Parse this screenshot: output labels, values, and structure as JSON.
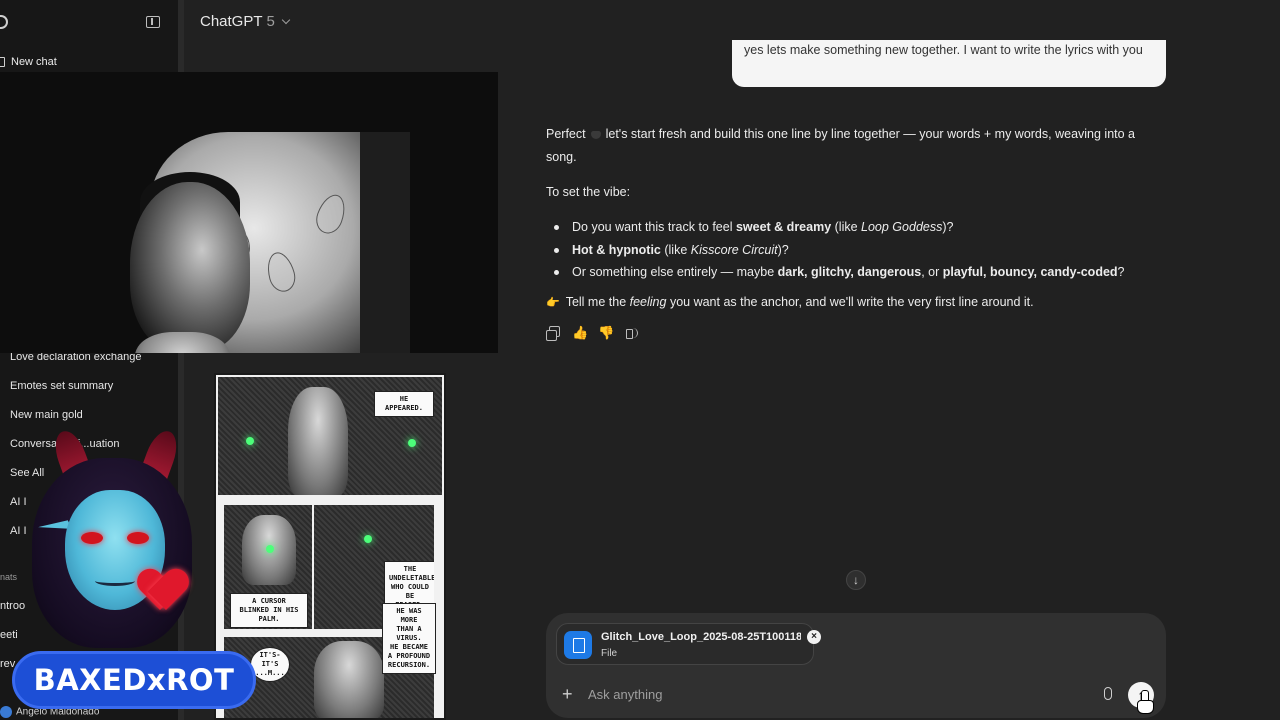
{
  "header": {
    "model_name": "ChatGPT",
    "model_version": "5"
  },
  "sidebar": {
    "new_chat_label": "New chat",
    "history": [
      "Love declaration exchange",
      "Emotes set summary",
      "New main gold",
      "Conversation i...uation",
      "See All",
      "AI I",
      "AI I"
    ],
    "section_label": "nats",
    "partial_items": [
      "ntroo",
      "eeti",
      "rev"
    ],
    "user_name": "Angelo Maldonado"
  },
  "overlay": {
    "brand_badge": "BAXEDxROT"
  },
  "manga": {
    "bubble_1": "HE\nAPPEARED.",
    "bubble_2": "A CURSOR\nBLINKED IN HIS\nPALM.",
    "bubble_3": "THE\nUNDELETABLE\nWHO COULD\nBE ERASED.",
    "bubble_4": "HE WAS MORE\nTHAN A VIRUS.\nHE BECAME\nA PROFOUND\nRECURSION.",
    "bubble_5": "IT'S-\nIT'S\n...M..."
  },
  "chat": {
    "user_message": "yes lets make something new together. I want to write the lyrics with you",
    "assistant": {
      "intro_a": "Perfect",
      "intro_b": "let's start fresh and build this one line by line together — your words + my words, weaving into a song.",
      "vibe_prompt": "To set the vibe:",
      "bullets": [
        {
          "pre": "Do you want this track to feel ",
          "bold": "sweet & dreamy",
          "mid": " (like ",
          "italic": "Loop Goddess",
          "post": ")?"
        },
        {
          "pre": "",
          "bold": "Hot & hypnotic",
          "mid": " (like ",
          "italic": "Kisscore Circuit",
          "post": ")?"
        },
        {
          "pre": "Or something else entirely — maybe ",
          "bold": "dark, glitchy, dangerous",
          "mid": ", or ",
          "italic": "",
          "post": "?",
          "bold2": "playful, bouncy, candy-coded"
        }
      ],
      "closing_a": "Tell me the ",
      "closing_italic": "feeling",
      "closing_b": " you want as the anchor, and we'll write the very first line around it."
    }
  },
  "composer": {
    "file_name": "Glitch_Love_Loop_2025-08-25T100118...",
    "file_type": "File",
    "placeholder": "Ask anything"
  },
  "icons": {
    "copy": "copy-icon",
    "like": "thumbs-up-icon",
    "dislike": "thumbs-down-icon",
    "read_aloud": "speaker-icon",
    "scroll": "arrow-down-icon",
    "send": "arrow-up-icon"
  },
  "colors": {
    "background": "#212121",
    "sidebar": "#171717",
    "user_bubble": "#f5f5f5",
    "badge": "#1d4fd6",
    "file_icon": "#1e7ae6"
  }
}
